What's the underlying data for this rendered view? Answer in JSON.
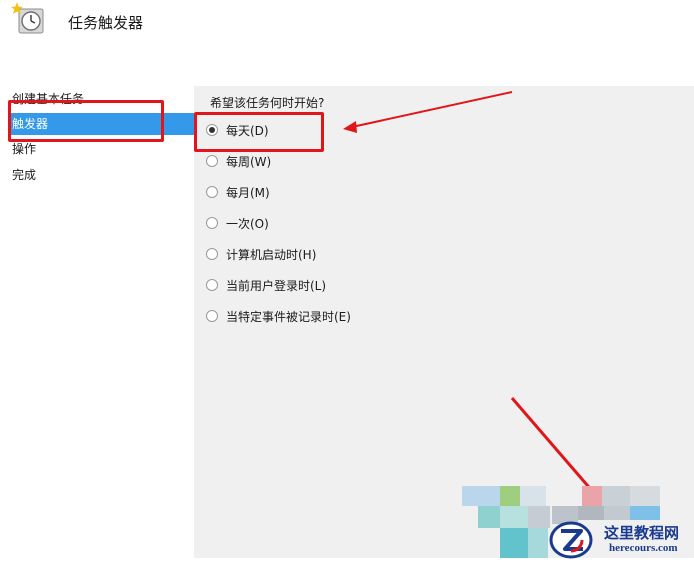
{
  "window": {
    "title": "任务触发器"
  },
  "sidebar": {
    "items": [
      {
        "label": "创建基本任务",
        "selected": false
      },
      {
        "label": "触发器",
        "selected": true
      },
      {
        "label": "操作",
        "selected": false
      },
      {
        "label": "完成",
        "selected": false
      }
    ]
  },
  "content": {
    "question": "希望该任务何时开始?",
    "options": [
      {
        "label": "每天(D)",
        "checked": true
      },
      {
        "label": "每周(W)",
        "checked": false
      },
      {
        "label": "每月(M)",
        "checked": false
      },
      {
        "label": "一次(O)",
        "checked": false
      },
      {
        "label": "计算机启动时(H)",
        "checked": false
      },
      {
        "label": "当前用户登录时(L)",
        "checked": false
      },
      {
        "label": "当特定事件被记录时(E)",
        "checked": false
      }
    ]
  },
  "watermark": {
    "site_name": "这里教程网",
    "site_url": "herecours.com"
  },
  "colors": {
    "selection": "#3399e8",
    "annotation": "#e0161b",
    "content_bg": "#f0f0f0"
  }
}
